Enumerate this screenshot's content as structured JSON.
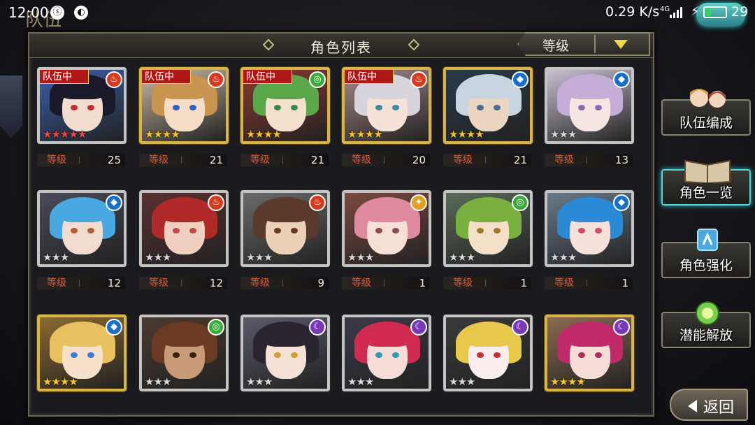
{
  "status_bar": {
    "time": "12:00",
    "speed": "0.29 K/s",
    "network": "4G",
    "battery": "29"
  },
  "screen_title": "队伍",
  "panel": {
    "title": "角色列表",
    "sort_label": "等级"
  },
  "level_label": "等级",
  "team_badge": "队伍中",
  "characters": [
    {
      "level": "25",
      "in_team": true,
      "element": "fire",
      "stars": 5,
      "star_color": "#e84a4a",
      "frame": "silver",
      "hair": "#1a1a2a",
      "skin": "#f2dccd",
      "eye": "#c03030",
      "bg": "#3a5fa8"
    },
    {
      "level": "21",
      "in_team": true,
      "element": "fire",
      "stars": 4,
      "star_color": "#f2c531",
      "frame": "gold",
      "hair": "#c89450",
      "skin": "#f4dcc6",
      "eye": "#3060c0",
      "bg": "#c8b8a0"
    },
    {
      "level": "21",
      "in_team": true,
      "element": "wind",
      "stars": 4,
      "star_color": "#f2c531",
      "frame": "gold",
      "hair": "#5aa84a",
      "skin": "#f4e0cc",
      "eye": "#3a8a4a",
      "bg": "#8a3a30"
    },
    {
      "level": "20",
      "in_team": true,
      "element": "fire",
      "stars": 4,
      "star_color": "#f2c531",
      "frame": "gold",
      "hair": "#d8d4de",
      "skin": "#f6e2d6",
      "eye": "#3a8aa0",
      "bg": "#a88888"
    },
    {
      "level": "21",
      "in_team": false,
      "element": "water",
      "stars": 4,
      "star_color": "#f2c531",
      "frame": "gold",
      "hair": "#c8d4e0",
      "skin": "#ecd6c2",
      "eye": "#4a6a90",
      "bg": "#2a3a4a"
    },
    {
      "level": "13",
      "in_team": false,
      "element": "water",
      "stars": 3,
      "star_color": "#d8d8d8",
      "frame": "silver",
      "hair": "#c4aed8",
      "skin": "#f6e6e2",
      "eye": "#8a6ab0",
      "bg": "#c8c0d0"
    },
    {
      "level": "12",
      "in_team": false,
      "element": "water",
      "stars": 3,
      "star_color": "#d8d8d8",
      "frame": "silver",
      "hair": "#4aa8e0",
      "skin": "#f2dccf",
      "eye": "#b06030",
      "bg": "#4a4a5a"
    },
    {
      "level": "12",
      "in_team": false,
      "element": "fire",
      "stars": 3,
      "star_color": "#d8d8d8",
      "frame": "silver",
      "hair": "#b02a2a",
      "skin": "#f0d0c0",
      "eye": "#c04a4a",
      "bg": "#5a3030"
    },
    {
      "level": "9",
      "in_team": false,
      "element": "fire",
      "stars": 3,
      "star_color": "#d8d8d8",
      "frame": "silver",
      "hair": "#5a3a2a",
      "skin": "#ecd0b8",
      "eye": "#6a3a1a",
      "bg": "#6a6a6a"
    },
    {
      "level": "1",
      "in_team": false,
      "element": "light",
      "stars": 3,
      "star_color": "#d8d8d8",
      "frame": "silver",
      "hair": "#e08aa0",
      "skin": "#f6e0d6",
      "eye": "#8a4a5a",
      "bg": "#7a4a40"
    },
    {
      "level": "1",
      "in_team": false,
      "element": "wind",
      "stars": 3,
      "star_color": "#d8d8d8",
      "frame": "silver",
      "hair": "#7ab040",
      "skin": "#f4e0c8",
      "eye": "#a07a2a",
      "bg": "#5a6a5a"
    },
    {
      "level": "1",
      "in_team": false,
      "element": "water",
      "stars": 3,
      "star_color": "#d8d8d8",
      "frame": "silver",
      "hair": "#2a8ad8",
      "skin": "#f6e2da",
      "eye": "#d04a6a",
      "bg": "#6a7a8a"
    },
    {
      "level": "",
      "in_team": false,
      "element": "water",
      "stars": 4,
      "star_color": "#f2c531",
      "frame": "gold",
      "hair": "#e8c060",
      "skin": "#f6e0ca",
      "eye": "#3a7ad0",
      "bg": "#8a6a30"
    },
    {
      "level": "",
      "in_team": false,
      "element": "wind",
      "stars": 3,
      "star_color": "#d8d8d8",
      "frame": "silver",
      "hair": "#6a3a22",
      "skin": "#c89a78",
      "eye": "#3a2010",
      "bg": "#4a3a30"
    },
    {
      "level": "",
      "in_team": false,
      "element": "dark",
      "stars": 3,
      "star_color": "#d8d8d8",
      "frame": "silver",
      "hair": "#2a2430",
      "skin": "#f4e0d4",
      "eye": "#d0a030",
      "bg": "#5a5a6a"
    },
    {
      "level": "",
      "in_team": false,
      "element": "dark",
      "stars": 3,
      "star_color": "#d8d8d8",
      "frame": "silver",
      "hair": "#d02a50",
      "skin": "#f6dcd6",
      "eye": "#2a9ab0",
      "bg": "#3a3a4a"
    },
    {
      "level": "",
      "in_team": false,
      "element": "dark",
      "stars": 3,
      "star_color": "#d8d8d8",
      "frame": "silver",
      "hair": "#e8c84a",
      "skin": "#f8ecec",
      "eye": "#c03030",
      "bg": "#3a3a3a"
    },
    {
      "level": "",
      "in_team": false,
      "element": "dark",
      "stars": 4,
      "star_color": "#f2c531",
      "frame": "gold",
      "hair": "#c02a6a",
      "skin": "#f6dcd6",
      "eye": "#b02a5a",
      "bg": "#8a6a50"
    }
  ],
  "element_colors": {
    "fire": "#d83a1e",
    "water": "#1a70c8",
    "wind": "#3aa83a",
    "light": "#e0a020",
    "dark": "#7a3ab8"
  },
  "menu": [
    {
      "label": "队伍编成",
      "icon": "team-portraits-icon",
      "active": false
    },
    {
      "label": "角色一览",
      "icon": "book-icon",
      "active": true
    },
    {
      "label": "角色强化",
      "icon": "enhance-crystal-icon",
      "active": false
    },
    {
      "label": "潜能解放",
      "icon": "potential-orb-icon",
      "active": false
    }
  ],
  "back_label": "返回"
}
